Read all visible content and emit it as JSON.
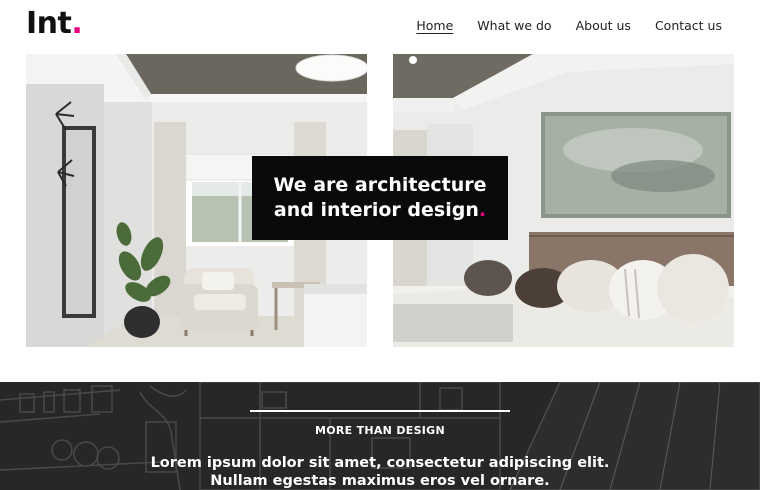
{
  "brand": {
    "logo_text": "Int",
    "logo_dot": ".",
    "accent_color": "#e6007e"
  },
  "nav": {
    "items": [
      {
        "label": "Home",
        "active": true
      },
      {
        "label": "What we do",
        "active": false
      },
      {
        "label": "About us",
        "active": false
      },
      {
        "label": "Contact us",
        "active": false
      }
    ]
  },
  "hero": {
    "headline_line1": "We are architecture",
    "headline_line2": "and interior design",
    "headline_dot": "."
  },
  "band": {
    "kicker": "MORE THAN DESIGN",
    "body": "Lorem ipsum dolor sit amet, consectetur adipiscing elit. Nullam egestas maximus eros vel ornare."
  }
}
